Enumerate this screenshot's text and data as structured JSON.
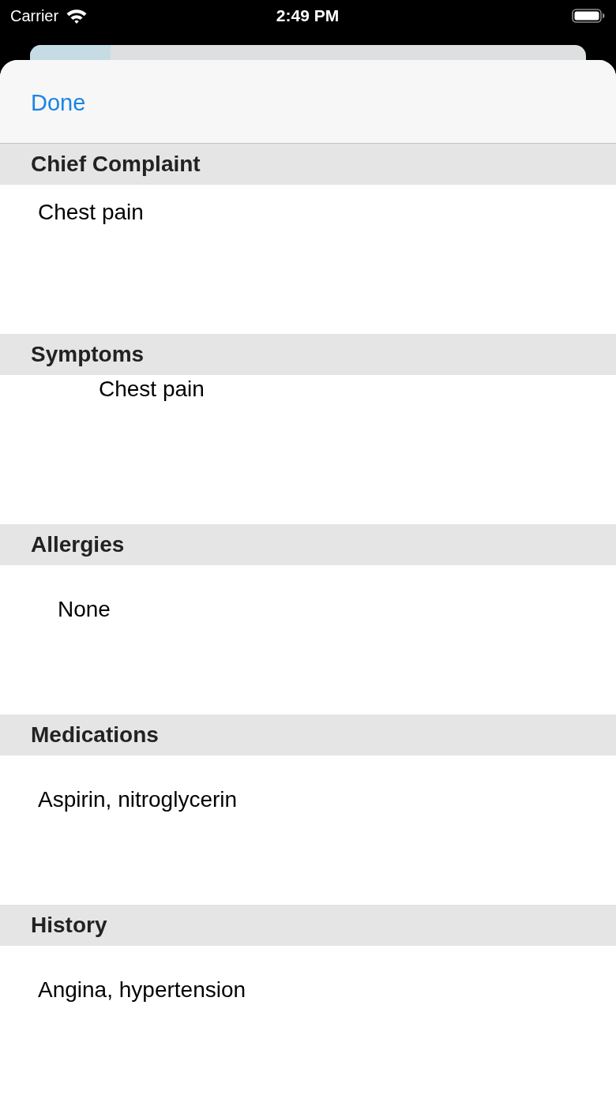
{
  "status_bar": {
    "carrier": "Carrier",
    "time": "2:49 PM"
  },
  "nav_bar": {
    "done_button": "Done"
  },
  "sections": [
    {
      "title": "Chief Complaint",
      "value": "Chest pain"
    },
    {
      "title": "Symptoms",
      "value": "Chest pain"
    },
    {
      "title": "Allergies",
      "value": "None"
    },
    {
      "title": "Medications",
      "value": "Aspirin, nitroglycerin"
    },
    {
      "title": "History",
      "value": "Angina, hypertension"
    }
  ]
}
